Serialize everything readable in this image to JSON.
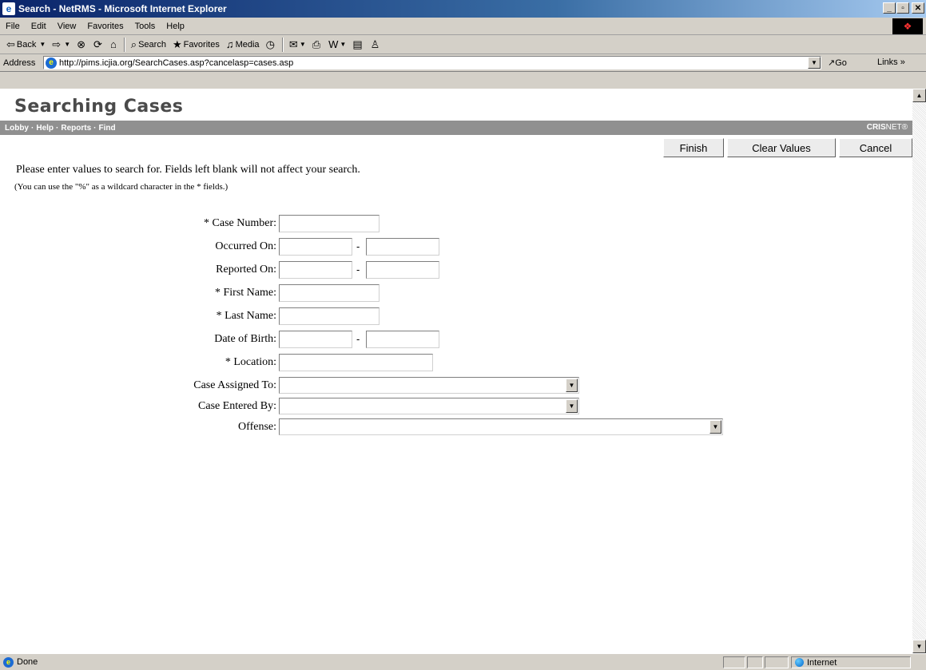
{
  "window": {
    "title": "Search - NetRMS - Microsoft Internet Explorer"
  },
  "menu": [
    "File",
    "Edit",
    "View",
    "Favorites",
    "Tools",
    "Help"
  ],
  "toolbar": {
    "back": "Back",
    "search": "Search",
    "favorites": "Favorites",
    "media": "Media"
  },
  "address": {
    "label": "Address",
    "url": "http://pims.icjia.org/SearchCases.asp?cancelasp=cases.asp",
    "go": "Go",
    "links": "Links"
  },
  "page": {
    "title": "Searching Cases",
    "nav": [
      "Lobby",
      "Help",
      "Reports",
      "Find"
    ],
    "brand_bold": "CRIS",
    "brand_rest": "NET®",
    "buttons": {
      "finish": "Finish",
      "clear": "Clear Values",
      "cancel": "Cancel"
    },
    "instruction": "Please enter values to search for. Fields left blank will not affect your search.",
    "instruction2": "(You can use the \"%\" as a wildcard character in the * fields.)",
    "fields": {
      "case_number": "* Case Number:",
      "occurred_on": "Occurred On:",
      "reported_on": "Reported On:",
      "first_name": "* First Name:",
      "last_name": "* Last Name:",
      "dob": "Date of Birth:",
      "location": "* Location:",
      "assigned_to": "Case Assigned To:",
      "entered_by": "Case Entered By:",
      "offense": "Offense:"
    },
    "dash": "-"
  },
  "status": {
    "text": "Done",
    "zone": "Internet"
  }
}
